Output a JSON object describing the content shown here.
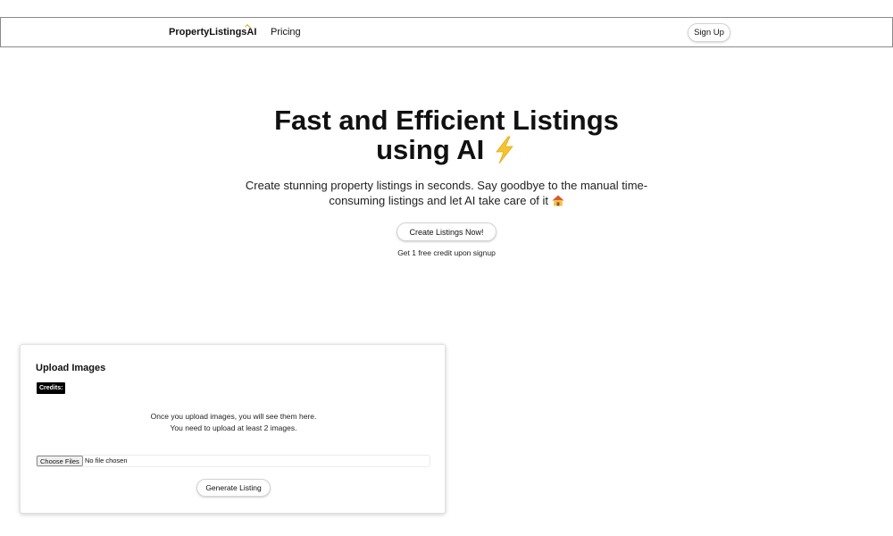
{
  "nav": {
    "brand_main": "PropertyListings",
    "brand_accent": "AI",
    "pricing_link": "Pricing",
    "signup_label": "Sign Up"
  },
  "hero": {
    "title_line1": "Fast and Efficient Listings",
    "title_line2": "using AI",
    "title_icon": "lightning-bolt-icon",
    "subtitle": "Create stunning property listings in seconds. Say goodbye to the manual time-consuming listings and let AI take care of it",
    "subtitle_icon": "house-icon",
    "cta_label": "Create Listings Now!",
    "cta_note": "Get 1 free credit upon signup"
  },
  "upload": {
    "title": "Upload Images",
    "credits_label": "Credits:",
    "empty_line1": "Once you upload images, you will see them here.",
    "empty_line2": "You need to upload at least 2 images.",
    "choose_files_label": "Choose Files",
    "file_status": "No file chosen",
    "generate_label": "Generate Listing"
  },
  "colors": {
    "bolt": "#f4c430",
    "house_roof": "#e0572d",
    "house_wall": "#f6c048"
  }
}
